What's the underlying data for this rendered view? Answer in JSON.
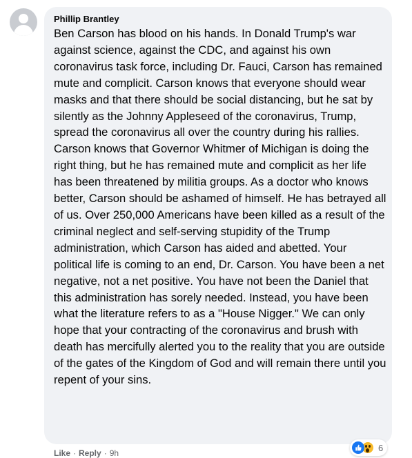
{
  "comment": {
    "author": "Phillip Brantley",
    "text": "Ben Carson has blood on his hands. In Donald Trump's war against science, against the CDC, and against his own coronavirus task force, including Dr. Fauci, Carson has remained mute and complicit. Carson knows that everyone should wear masks and that there should be social distancing, but he sat by silently as the Johnny Appleseed of the coronavirus, Trump, spread the coronavirus all over the country during his rallies. Carson knows that Governor Whitmer of Michigan is doing the right thing, but he has remained mute and complicit as her life has been threatened by militia groups. As a doctor who knows better, Carson should be ashamed of himself. He has betrayed all of us. Over 250,000 Americans have been killed as a result of the criminal neglect and self-serving stupidity of the Trump administration, which Carson has aided and abetted. Your political life is coming to an end, Dr. Carson. You have been a net negative, not a net positive. You have not been the Daniel that this administration has sorely needed. Instead, you have been what the literature refers to as a \"House Nigger.\" We can only hope that your contracting of the coronavirus and brush with death has mercifully alerted you to the reality that you are outside of the gates of the Kingdom of God and will remain there until you repent of your sins.",
    "reactions": {
      "icons": [
        "like-icon",
        "wow-icon"
      ],
      "count": "6",
      "colors": {
        "like": "#1877f2",
        "wow": "#f7b928"
      }
    },
    "actions": {
      "like_label": "Like",
      "reply_label": "Reply",
      "separator": "·",
      "timestamp": "9h"
    }
  }
}
